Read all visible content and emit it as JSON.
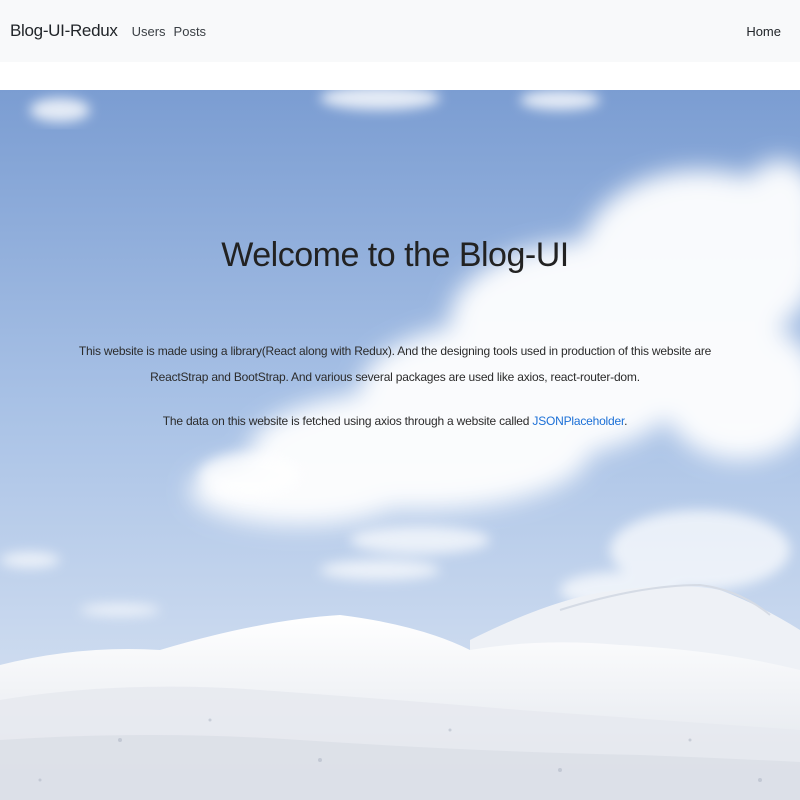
{
  "navbar": {
    "brand": "Blog-UI-Redux",
    "links": [
      "Users",
      "Posts"
    ],
    "right_link": "Home"
  },
  "hero": {
    "title": "Welcome to the Blog-UI",
    "paragraph1": "This website is made using a library(React along with Redux). And the designing tools used in production of this website are ReactStrap and BootStrap. And various several packages are used like axios, react-router-dom.",
    "paragraph2_prefix": "The data on this website is fetched using axios through a website called ",
    "paragraph2_link": "JSONPlaceholder",
    "paragraph2_suffix": "."
  },
  "colors": {
    "navbar_bg": "#f8f9fa",
    "link": "#1a6fd6",
    "sky_top": "#7fa1d4",
    "snow": "#f2f4f8"
  }
}
